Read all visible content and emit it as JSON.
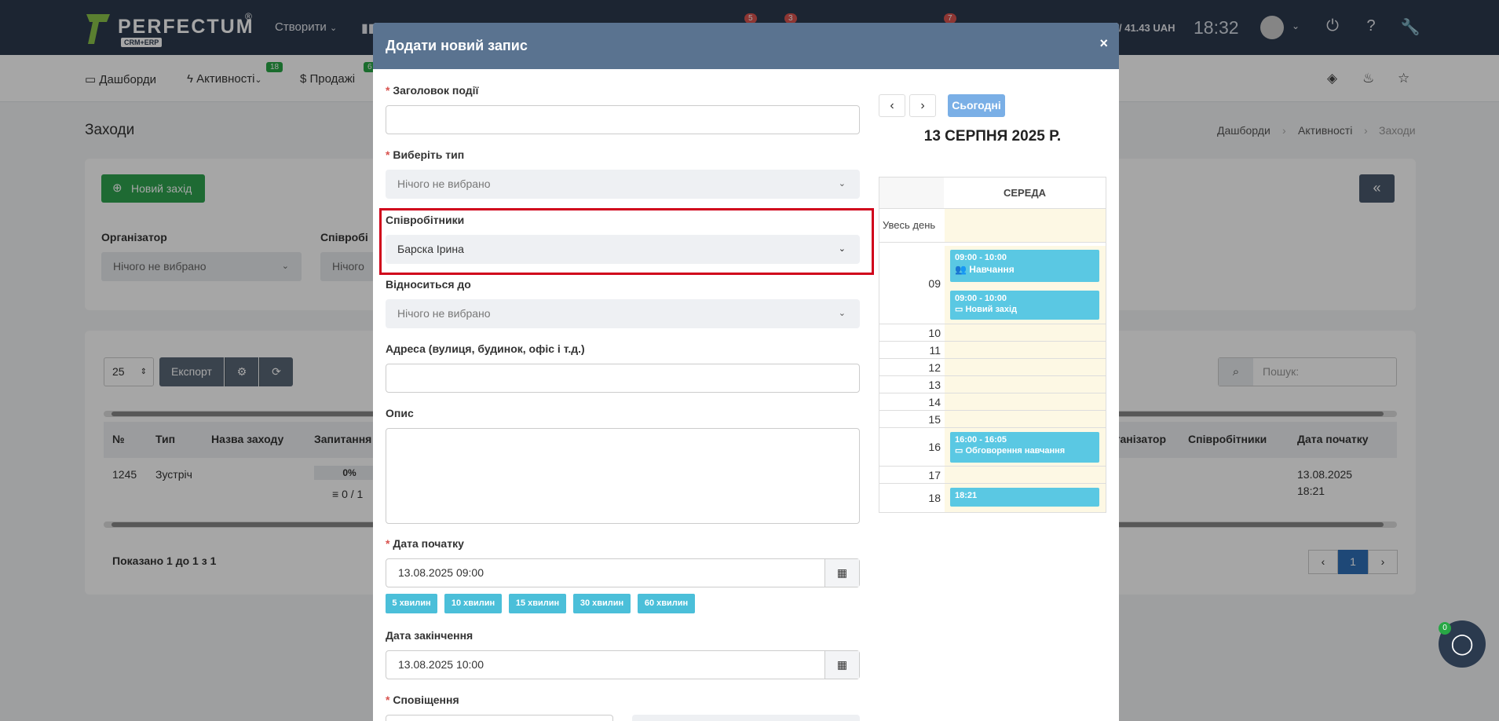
{
  "topbar": {
    "logo_text": "PERFECTUM",
    "logo_reg": "®",
    "logo_sub": "CRM+ERP",
    "create_label": "Створити",
    "badges": [
      "5",
      "3",
      "7"
    ],
    "balance": "/ 41.43 UAH",
    "clock": "18:32"
  },
  "subnav": {
    "items": [
      {
        "label": "Дашборди",
        "icon": "monitor-icon"
      },
      {
        "label": "Активності",
        "icon": "bolt-icon",
        "badge": "18"
      },
      {
        "label": "Продажі",
        "icon": "dollar-icon",
        "badge": "6"
      }
    ]
  },
  "page": {
    "title": "Заходи",
    "breadcrumb": [
      "Дашборди",
      "Активності",
      "Заходи"
    ],
    "new_button": "Новий захід",
    "collapse": "«",
    "filters": [
      {
        "label": "Організатор",
        "value": "Нічого не вибрано"
      },
      {
        "label": "Співробі",
        "value": "Нічого"
      }
    ],
    "per_page": "25",
    "export_label": "Експорт",
    "search_placeholder": "Пошук:",
    "columns_left": [
      "№",
      "Тип",
      "Назва заходу",
      "Запитання"
    ],
    "columns_right": [
      "Організатор",
      "Співробітники",
      "Дата початку"
    ],
    "row": {
      "id": "1245",
      "type": "Зустріч",
      "progress": "0%",
      "progress_value": 0,
      "questions": "0 / 1",
      "start_date": "13.08.2025",
      "start_time": "18:21"
    },
    "shown": "Показано 1 до 1 з 1",
    "pager": {
      "prev": "‹",
      "current": "1",
      "next": "›"
    }
  },
  "chat": {
    "badge": "0"
  },
  "modal": {
    "title": "Додати новий запис",
    "close": "×",
    "fields": {
      "event_title": {
        "label": "Заголовок події",
        "value": ""
      },
      "type": {
        "label": "Виберіть тип",
        "value": "Нічого не вибрано"
      },
      "employees": {
        "label": "Співробітники",
        "value": "Барска Ірина"
      },
      "related": {
        "label": "Відноситься до",
        "value": "Нічого не вибрано"
      },
      "address": {
        "label": "Адреса (вулиця, будинок, офіс і т.д.)",
        "value": ""
      },
      "description": {
        "label": "Опис",
        "value": ""
      },
      "start": {
        "label": "Дата початку",
        "value": "13.08.2025 09:00"
      },
      "end": {
        "label": "Дата закінчення",
        "value": "13.08.2025 10:00"
      },
      "notifications": {
        "label": "Сповіщення"
      }
    },
    "quick_buttons": [
      "5 хвилин",
      "10 хвилин",
      "15 хвилин",
      "30 хвилин",
      "60 хвилин"
    ],
    "calendar": {
      "today_label": "Сьогодні",
      "title": "13 СЕРПНЯ 2025 Р.",
      "day_header": "СЕРЕДА",
      "allday_label": "Увесь день",
      "hours": [
        "09",
        "10",
        "11",
        "12",
        "13",
        "14",
        "15",
        "16",
        "17",
        "18"
      ],
      "events": [
        {
          "time": "09:00 - 10:00",
          "title": "Навчання",
          "icon": "users-icon"
        },
        {
          "time": "09:00 - 10:00",
          "title": "Новий захід",
          "icon": "calendar-icon"
        },
        {
          "time": "16:00 - 16:05",
          "title": "Обговорення навчання",
          "icon": "calendar-icon"
        },
        {
          "time": "18:21",
          "title": ""
        }
      ]
    }
  },
  "colors": {
    "navbar": "#2b3a4e",
    "modal_header": "#5a7390",
    "highlight": "#d0021b",
    "event": "#5ac8e3",
    "green": "#2ea44f"
  }
}
